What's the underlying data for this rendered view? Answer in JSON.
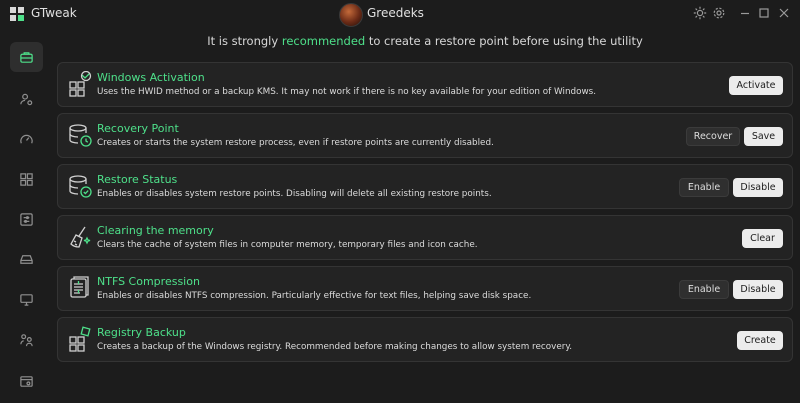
{
  "app": {
    "title": "GTweak",
    "user": "Greedeks"
  },
  "notice": {
    "before": "It is strongly ",
    "accent": "recommended",
    "after": " to create a restore point before using the utility"
  },
  "colors": {
    "accent": "#4ee08a",
    "background": "#1c1c1c",
    "card": "#232323"
  },
  "sidebar": {
    "items": [
      {
        "icon": "briefcase-icon",
        "active": true
      },
      {
        "icon": "user-settings-icon",
        "active": false
      },
      {
        "icon": "gauge-icon",
        "active": false
      },
      {
        "icon": "apps-grid-icon",
        "active": false
      },
      {
        "icon": "settings-sliders-icon",
        "active": false
      },
      {
        "icon": "drive-icon",
        "active": false
      },
      {
        "icon": "monitor-icon",
        "active": false
      },
      {
        "icon": "user-group-icon",
        "active": false
      },
      {
        "icon": "system-info-icon",
        "active": false
      }
    ]
  },
  "cards": [
    {
      "title": "Windows Activation",
      "desc": "Uses the HWID method or a backup KMS. It may not work if there is no key available for your edition of Windows.",
      "buttons": [
        "Activate"
      ],
      "icon": "activation-icon"
    },
    {
      "title": "Recovery Point",
      "desc": "Creates or starts the system restore process, even if restore points are currently disabled.",
      "buttons": [
        "Recover",
        "Save"
      ],
      "icon": "database-restore-icon"
    },
    {
      "title": "Restore Status",
      "desc": "Enables or disables system restore points. Disabling will delete all existing restore points.",
      "buttons": [
        "Enable",
        "Disable"
      ],
      "icon": "database-status-icon"
    },
    {
      "title": "Clearing the memory",
      "desc": "Clears the cache of system files in computer memory, temporary files and icon cache.",
      "buttons": [
        "Clear"
      ],
      "icon": "broom-icon"
    },
    {
      "title": "NTFS Compression",
      "desc": "Enables or disables NTFS compression. Particularly effective for text files, helping save disk space.",
      "buttons": [
        "Enable",
        "Disable"
      ],
      "icon": "compress-icon"
    },
    {
      "title": "Registry Backup",
      "desc": "Creates a backup of the Windows registry. Recommended before making changes to allow system recovery.",
      "buttons": [
        "Create"
      ],
      "icon": "registry-icon"
    }
  ]
}
